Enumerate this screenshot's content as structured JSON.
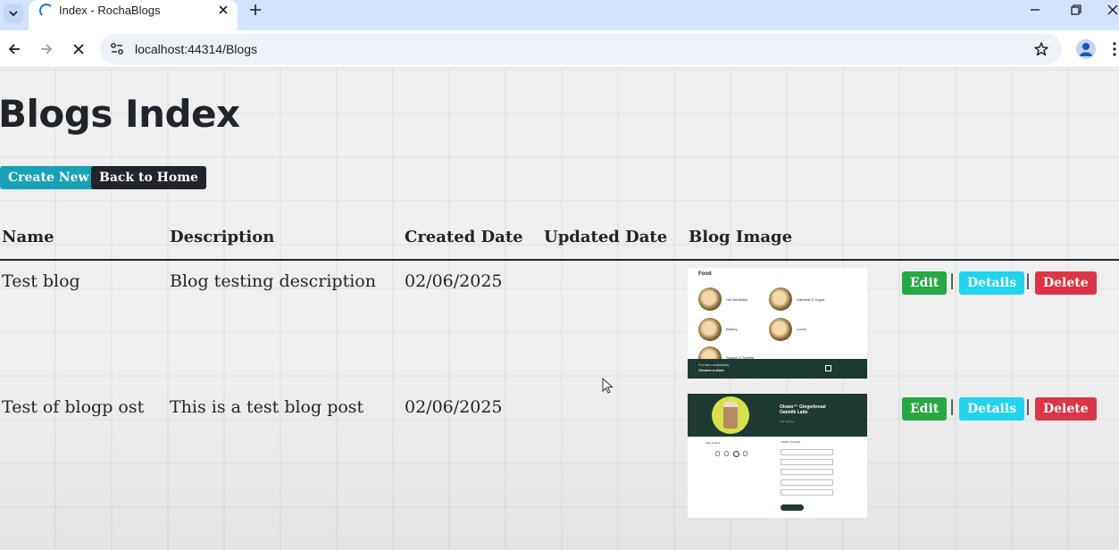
{
  "browser": {
    "tab_title": "Index - RochaBlogs",
    "url": "localhost:44314/Blogs"
  },
  "page": {
    "title": "Blogs Index",
    "create_new_label": "Create New",
    "back_home_label": "Back to Home"
  },
  "table": {
    "headers": [
      "Name",
      "Description",
      "Created Date",
      "Updated Date",
      "Blog Image"
    ],
    "rows": [
      {
        "name": "Test blog",
        "description": "Blog testing description",
        "created_date": "02/06/2025",
        "updated_date": "",
        "image": {
          "heading": "Food",
          "items": [
            "Hot Breakfast",
            "Oatmeal & Yogurt",
            "Bakery",
            "Lunch",
            "Snacks & Sweets"
          ],
          "footer_small": "For item availability",
          "footer_main": "Choose a store"
        }
      },
      {
        "name": "Test of blogp ost",
        "description": "This is a test blog post",
        "created_date": "02/06/2025",
        "updated_date": "",
        "image": {
          "product_name": "Oleato™ Gingerbread Oatmilk Latte",
          "product_sub": "120 calories",
          "size_heading": "Size options",
          "included_heading": "What's included",
          "button": "Customize"
        }
      }
    ],
    "actions": {
      "edit": "Edit",
      "details": "Details",
      "delete": "Delete",
      "separator": "|"
    }
  },
  "colors": {
    "create_new": "#17a2b8",
    "back_home": "#212529",
    "edit": "#28a745",
    "details": "#22d3ee",
    "delete": "#dc3545",
    "tab_strip": "#d3e3fd"
  },
  "icons": [
    "tab-list-icon",
    "loading-spinner-icon",
    "close-tab-icon",
    "new-tab-icon",
    "minimize-icon",
    "restore-icon",
    "close-window-icon",
    "back-icon",
    "forward-icon",
    "stop-loading-icon",
    "site-info-icon",
    "bookmark-star-icon",
    "profile-icon",
    "menu-icon",
    "shopping-bag-icon"
  ]
}
